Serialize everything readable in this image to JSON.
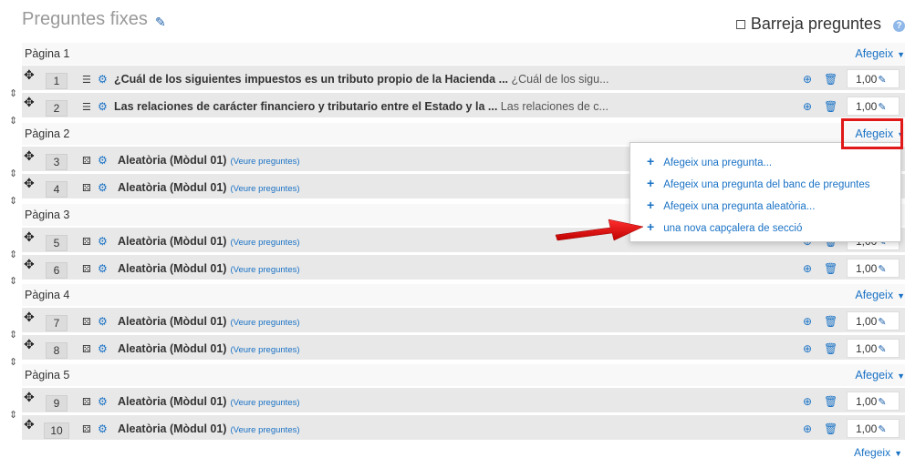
{
  "header": {
    "title": "Preguntes fixes",
    "shuffle_label": "Barreja preguntes",
    "help": "?"
  },
  "add_label": "Afegeix",
  "view_label": "(Veure preguntes)",
  "pages": [
    {
      "label": "Pàgina 1"
    },
    {
      "label": "Pàgina 2"
    },
    {
      "label": "Pàgina 3"
    },
    {
      "label": "Pàgina 4"
    },
    {
      "label": "Pàgina 5"
    }
  ],
  "slots": [
    {
      "number": "1",
      "title": "¿Cuál de los siguientes impuestos es un tributo propio de la Hacienda ...",
      "preview": "¿Cuál de los sigu...",
      "mark": "1,00"
    },
    {
      "number": "2",
      "title": "Las relaciones de carácter financiero y tributario entre el Estado y la ...",
      "preview": "Las relaciones de c...",
      "mark": "1,00"
    },
    {
      "number": "3",
      "title": "Aleatòria (Mòdul 01)"
    },
    {
      "number": "4",
      "title": "Aleatòria (Mòdul 01)"
    },
    {
      "number": "5",
      "title": "Aleatòria (Mòdul 01)",
      "mark": "1,00"
    },
    {
      "number": "6",
      "title": "Aleatòria (Mòdul 01)",
      "mark": "1,00"
    },
    {
      "number": "7",
      "title": "Aleatòria (Mòdul 01)",
      "mark": "1,00"
    },
    {
      "number": "8",
      "title": "Aleatòria (Mòdul 01)",
      "mark": "1,00"
    },
    {
      "number": "9",
      "title": "Aleatòria (Mòdul 01)",
      "mark": "1,00"
    },
    {
      "number": "10",
      "title": "Aleatòria (Mòdul 01)",
      "mark": "1,00"
    }
  ],
  "dropdown": {
    "items": [
      "Afegeix una pregunta...",
      "Afegeix una pregunta del banc de preguntes",
      "Afegeix una pregunta aleatòria...",
      "una nova capçalera de secció"
    ]
  },
  "colors": {
    "link": "#1a72c5",
    "highlight": "#e01818",
    "row_bg": "#e8e8e8"
  }
}
